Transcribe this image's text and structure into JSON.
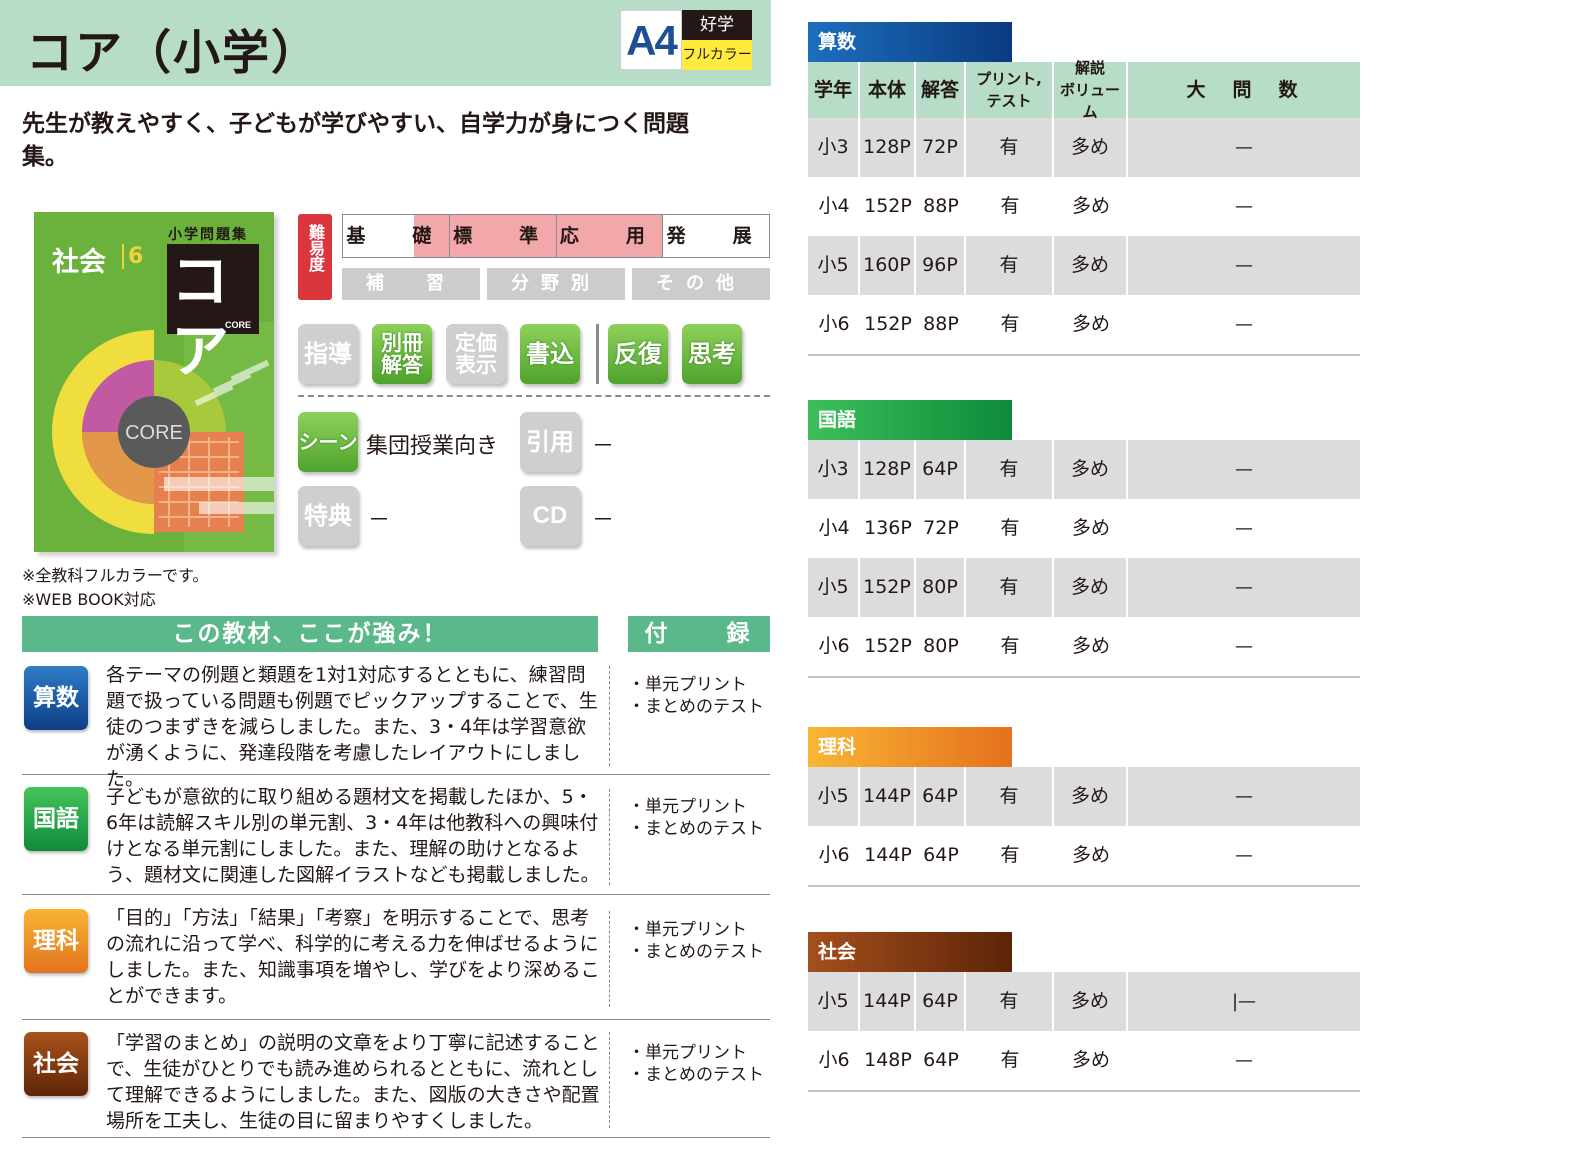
{
  "header": {
    "title": "コア（小学）",
    "format": "A4",
    "badge_top": "好学",
    "badge_bottom": "フルカラー"
  },
  "lead": "先生が教えやすく、子どもが学びやすい、自学力が身につく問題集。",
  "cover": {
    "series": "小学問題集",
    "subject": "社会",
    "grade": "6",
    "logo": "コア",
    "logo_sub": "CORE",
    "circle_label": "CORE"
  },
  "notes": [
    "※全教科フルカラーです。",
    "※WEB BOOK対応"
  ],
  "difficulty": {
    "label": "難易度",
    "levels": [
      "基　礎",
      "標　準",
      "応　用",
      "発　展"
    ],
    "highlighted_from": "基礎",
    "highlighted_to": "応用",
    "sub": [
      "補　習",
      "分野別",
      "その他"
    ]
  },
  "features": {
    "shido": "指導",
    "bessatsu": "別冊\n解答",
    "teika": "定価\n表示",
    "kakikomi": "書込",
    "hanpuku": "反復",
    "shiko": "思考",
    "scene_label": "シーン",
    "scene_value": "集団授業向き",
    "inyo_label": "引用",
    "inyo_value": "－",
    "tokuten_label": "特典",
    "tokuten_value": "－",
    "cd_label": "CD",
    "cd_value": "－"
  },
  "strengths": {
    "header": "この教材、ここが強み！",
    "furoku_header": "付　録",
    "rows": [
      {
        "subject": "算数",
        "color": "#0d3f86",
        "text": "各テーマの例題と類題を1対1対応するとともに、練習問題で扱っている問題も例題でピックアップすることで、生徒のつまずきを減らしました。また、3・4年は学習意欲が湧くように、発達段階を考慮したレイアウトにしました。",
        "furoku": [
          "・単元プリント",
          "・まとめのテスト"
        ]
      },
      {
        "subject": "国語",
        "color": "#0f8a3a",
        "text": "子どもが意欲的に取り組める題材文を掲載したほか、5・6年は読解スキル別の単元割、3・4年は他教科への興味付けとなる単元割にしました。また、理解の助けとなるよう、題材文に関連した図解イラストなども掲載しました。",
        "furoku": [
          "・単元プリント",
          "・まとめのテスト"
        ]
      },
      {
        "subject": "理科",
        "color": "#e4731f",
        "text": "「目的」「方法」「結果」「考察」を明示することで、思考の流れに沿って学べ、科学的に考える力を伸ばせるようにしました。また、知識事項を増やし、学びをより深めることができます。",
        "furoku": [
          "・単元プリント",
          "・まとめのテスト"
        ]
      },
      {
        "subject": "社会",
        "color": "#5f2508",
        "text": "「学習のまとめ」の説明の文章をより丁寧に記述することで、生徒がひとりでも読み進められるとともに、流れとして理解できるようにしました。また、図版の大きさや配置場所を工夫し、生徒の目に留まりやすくしました。",
        "furoku": [
          "・単元プリント",
          "・まとめのテスト"
        ]
      }
    ]
  },
  "table": {
    "columns": [
      "学年",
      "本体",
      "解答",
      "プリント,\nテスト",
      "解説\nボリューム",
      "大　問　数"
    ],
    "sections": [
      {
        "name": "算数",
        "rows": [
          {
            "grade": "小3",
            "body": "128P",
            "answer": "72P",
            "print": "有",
            "volume": "多め",
            "count": "—"
          },
          {
            "grade": "小4",
            "body": "152P",
            "answer": "88P",
            "print": "有",
            "volume": "多め",
            "count": "—"
          },
          {
            "grade": "小5",
            "body": "160P",
            "answer": "96P",
            "print": "有",
            "volume": "多め",
            "count": "—"
          },
          {
            "grade": "小6",
            "body": "152P",
            "answer": "88P",
            "print": "有",
            "volume": "多め",
            "count": "—"
          }
        ]
      },
      {
        "name": "国語",
        "rows": [
          {
            "grade": "小3",
            "body": "128P",
            "answer": "64P",
            "print": "有",
            "volume": "多め",
            "count": "—"
          },
          {
            "grade": "小4",
            "body": "136P",
            "answer": "72P",
            "print": "有",
            "volume": "多め",
            "count": "—"
          },
          {
            "grade": "小5",
            "body": "152P",
            "answer": "80P",
            "print": "有",
            "volume": "多め",
            "count": "—"
          },
          {
            "grade": "小6",
            "body": "152P",
            "answer": "80P",
            "print": "有",
            "volume": "多め",
            "count": "—"
          }
        ]
      },
      {
        "name": "理科",
        "rows": [
          {
            "grade": "小5",
            "body": "144P",
            "answer": "64P",
            "print": "有",
            "volume": "多め",
            "count": "—"
          },
          {
            "grade": "小6",
            "body": "144P",
            "answer": "64P",
            "print": "有",
            "volume": "多め",
            "count": "—"
          }
        ]
      },
      {
        "name": "社会",
        "rows": [
          {
            "grade": "小5",
            "body": "144P",
            "answer": "64P",
            "print": "有",
            "volume": "多め",
            "count": "|—"
          },
          {
            "grade": "小6",
            "body": "148P",
            "answer": "64P",
            "print": "有",
            "volume": "多め",
            "count": "—"
          }
        ]
      }
    ]
  }
}
